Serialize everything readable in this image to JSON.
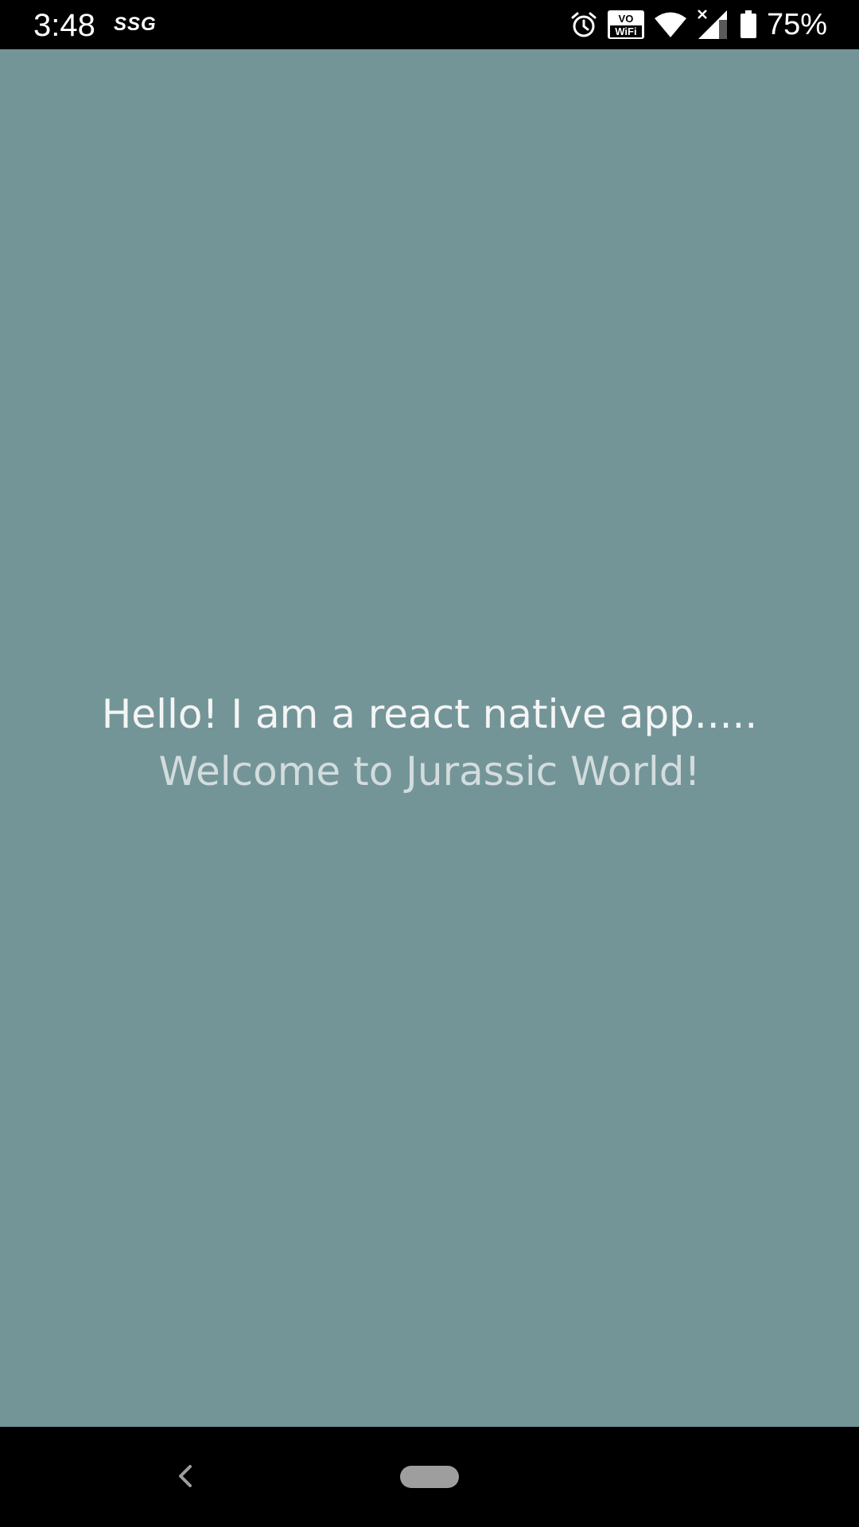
{
  "status_bar": {
    "time": "3:48",
    "carrier_badge": "SSG",
    "vowifi_top": "VO",
    "vowifi_bottom": "WiFi",
    "battery_percent": "75%",
    "icons": [
      "alarm-icon",
      "vowifi-icon",
      "wifi-icon",
      "cell-signal-icon",
      "battery-icon"
    ]
  },
  "app": {
    "background_color": "#739598",
    "line1": "Hello! I am a react native app.....",
    "line2": "Welcome to Jurassic World!"
  },
  "nav_bar": {
    "icons": [
      "back-icon",
      "home-pill"
    ]
  }
}
